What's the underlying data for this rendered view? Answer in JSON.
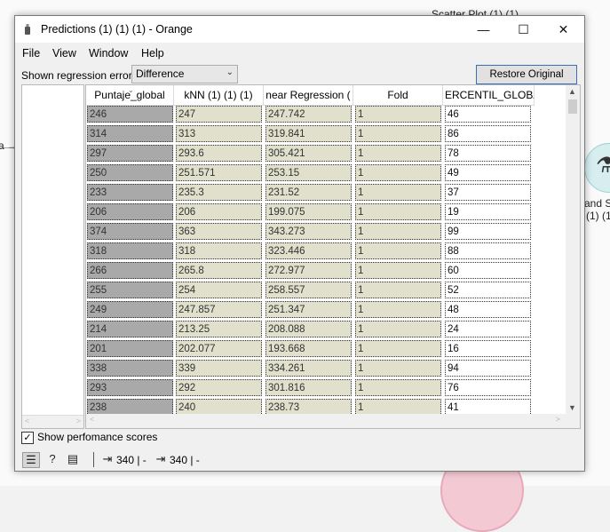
{
  "background": {
    "scatter_plot_label": "Scatter Plot (1) (1)",
    "left_edge_label": "a →",
    "right_label_line1": "and Sc",
    "right_label_line2": "(1) (1",
    "node_icon": "flask-icon"
  },
  "window": {
    "title": "Predictions (1) (1) (1) - Orange",
    "controls": {
      "minimize": "—",
      "maximize": "☐",
      "close": "✕"
    }
  },
  "menu": [
    "File",
    "View",
    "Window",
    "Help"
  ],
  "controls": {
    "regression_error_label": "Shown regression error:",
    "regression_error_value": "Difference",
    "restore_button": "Restore Original Order"
  },
  "table": {
    "columns": [
      "Puntaje_global",
      "kNN (1) (1) (1)",
      "near Regression (",
      "Fold",
      "ERCENTIL_GLOBA"
    ],
    "rows": [
      [
        "246",
        "247",
        "247.742",
        "1",
        "46"
      ],
      [
        "314",
        "313",
        "319.841",
        "1",
        "86"
      ],
      [
        "297",
        "293.6",
        "305.421",
        "1",
        "78"
      ],
      [
        "250",
        "251.571",
        "253.15",
        "1",
        "49"
      ],
      [
        "233",
        "235.3",
        "231.52",
        "1",
        "37"
      ],
      [
        "206",
        "206",
        "199.075",
        "1",
        "19"
      ],
      [
        "374",
        "363",
        "343.273",
        "1",
        "99"
      ],
      [
        "318",
        "318",
        "323.446",
        "1",
        "88"
      ],
      [
        "266",
        "265.8",
        "272.977",
        "1",
        "60"
      ],
      [
        "255",
        "254",
        "258.557",
        "1",
        "52"
      ],
      [
        "249",
        "247.857",
        "251.347",
        "1",
        "48"
      ],
      [
        "214",
        "213.25",
        "208.088",
        "1",
        "24"
      ],
      [
        "201",
        "202.077",
        "193.668",
        "1",
        "16"
      ],
      [
        "338",
        "339",
        "334.261",
        "1",
        "94"
      ],
      [
        "293",
        "292",
        "301.816",
        "1",
        "76"
      ],
      [
        "238",
        "240",
        "238.73",
        "1",
        "41"
      ]
    ]
  },
  "perf": {
    "label": "Show perfomance scores",
    "checked": true,
    "check_glyph": "✓"
  },
  "status": {
    "input_count": "340 | -",
    "output_count": "340 | -"
  },
  "colors": {
    "actual": "#a9a9a9",
    "predicted": "#e0e0cc",
    "meta": "#ffffff",
    "accent": "#3c6eb4"
  }
}
